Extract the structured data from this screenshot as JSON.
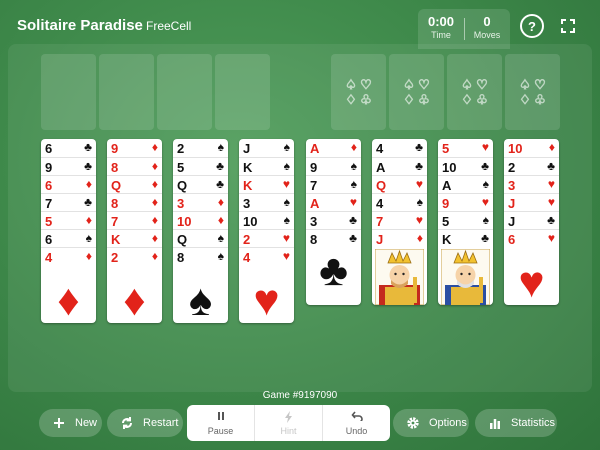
{
  "header": {
    "title": "Solitaire Paradise",
    "mode": "FreeCell",
    "time_value": "0:00",
    "time_label": "Time",
    "moves_value": "0",
    "moves_label": "Moves",
    "help_glyph": "?"
  },
  "foundation_suits": [
    "♤",
    "♡",
    "♢",
    "♧"
  ],
  "columns": [
    [
      {
        "rank": "6",
        "suit": "♣",
        "color": "black"
      },
      {
        "rank": "9",
        "suit": "♣",
        "color": "black"
      },
      {
        "rank": "6",
        "suit": "♦",
        "color": "red"
      },
      {
        "rank": "7",
        "suit": "♣",
        "color": "black"
      },
      {
        "rank": "5",
        "suit": "♦",
        "color": "red"
      },
      {
        "rank": "6",
        "suit": "♠",
        "color": "black"
      },
      {
        "rank": "4",
        "suit": "♦",
        "color": "red",
        "face": "pip"
      }
    ],
    [
      {
        "rank": "9",
        "suit": "♦",
        "color": "red"
      },
      {
        "rank": "8",
        "suit": "♦",
        "color": "red"
      },
      {
        "rank": "Q",
        "suit": "♦",
        "color": "red"
      },
      {
        "rank": "8",
        "suit": "♦",
        "color": "red"
      },
      {
        "rank": "7",
        "suit": "♦",
        "color": "red"
      },
      {
        "rank": "K",
        "suit": "♦",
        "color": "red"
      },
      {
        "rank": "2",
        "suit": "♦",
        "color": "red",
        "face": "pip"
      }
    ],
    [
      {
        "rank": "2",
        "suit": "♠",
        "color": "black"
      },
      {
        "rank": "5",
        "suit": "♣",
        "color": "black"
      },
      {
        "rank": "Q",
        "suit": "♣",
        "color": "black"
      },
      {
        "rank": "3",
        "suit": "♦",
        "color": "red"
      },
      {
        "rank": "10",
        "suit": "♦",
        "color": "red"
      },
      {
        "rank": "Q",
        "suit": "♠",
        "color": "black"
      },
      {
        "rank": "8",
        "suit": "♠",
        "color": "black",
        "face": "pip"
      }
    ],
    [
      {
        "rank": "J",
        "suit": "♠",
        "color": "black"
      },
      {
        "rank": "K",
        "suit": "♠",
        "color": "black"
      },
      {
        "rank": "K",
        "suit": "♥",
        "color": "red"
      },
      {
        "rank": "3",
        "suit": "♠",
        "color": "black"
      },
      {
        "rank": "10",
        "suit": "♠",
        "color": "black"
      },
      {
        "rank": "2",
        "suit": "♥",
        "color": "red"
      },
      {
        "rank": "4",
        "suit": "♥",
        "color": "red",
        "face": "pip"
      }
    ],
    [
      {
        "rank": "A",
        "suit": "♦",
        "color": "red"
      },
      {
        "rank": "9",
        "suit": "♠",
        "color": "black"
      },
      {
        "rank": "7",
        "suit": "♠",
        "color": "black"
      },
      {
        "rank": "A",
        "suit": "♥",
        "color": "red"
      },
      {
        "rank": "3",
        "suit": "♣",
        "color": "black"
      },
      {
        "rank": "8",
        "suit": "♣",
        "color": "black",
        "face": "pip"
      }
    ],
    [
      {
        "rank": "4",
        "suit": "♣",
        "color": "black"
      },
      {
        "rank": "A",
        "suit": "♣",
        "color": "black"
      },
      {
        "rank": "Q",
        "suit": "♥",
        "color": "red"
      },
      {
        "rank": "4",
        "suit": "♠",
        "color": "black"
      },
      {
        "rank": "7",
        "suit": "♥",
        "color": "red"
      },
      {
        "rank": "J",
        "suit": "♦",
        "color": "red",
        "face": "court"
      }
    ],
    [
      {
        "rank": "5",
        "suit": "♥",
        "color": "red"
      },
      {
        "rank": "10",
        "suit": "♣",
        "color": "black"
      },
      {
        "rank": "A",
        "suit": "♠",
        "color": "black"
      },
      {
        "rank": "9",
        "suit": "♥",
        "color": "red"
      },
      {
        "rank": "5",
        "suit": "♠",
        "color": "black"
      },
      {
        "rank": "K",
        "suit": "♣",
        "color": "black",
        "face": "court"
      }
    ],
    [
      {
        "rank": "10",
        "suit": "♦",
        "color": "red"
      },
      {
        "rank": "2",
        "suit": "♣",
        "color": "black"
      },
      {
        "rank": "3",
        "suit": "♥",
        "color": "red"
      },
      {
        "rank": "J",
        "suit": "♥",
        "color": "red"
      },
      {
        "rank": "J",
        "suit": "♣",
        "color": "black"
      },
      {
        "rank": "6",
        "suit": "♥",
        "color": "red",
        "face": "pip"
      }
    ]
  ],
  "game_number": "Game #9197090",
  "bottom": {
    "new_label": "New",
    "restart_label": "Restart",
    "pause_label": "Pause",
    "hint_label": "Hint",
    "undo_label": "Undo",
    "options_label": "Options",
    "statistics_label": "Statistics"
  },
  "colors": {
    "felt": "#3f8a4b",
    "card_red": "#e2231a",
    "card_black": "#111111"
  }
}
